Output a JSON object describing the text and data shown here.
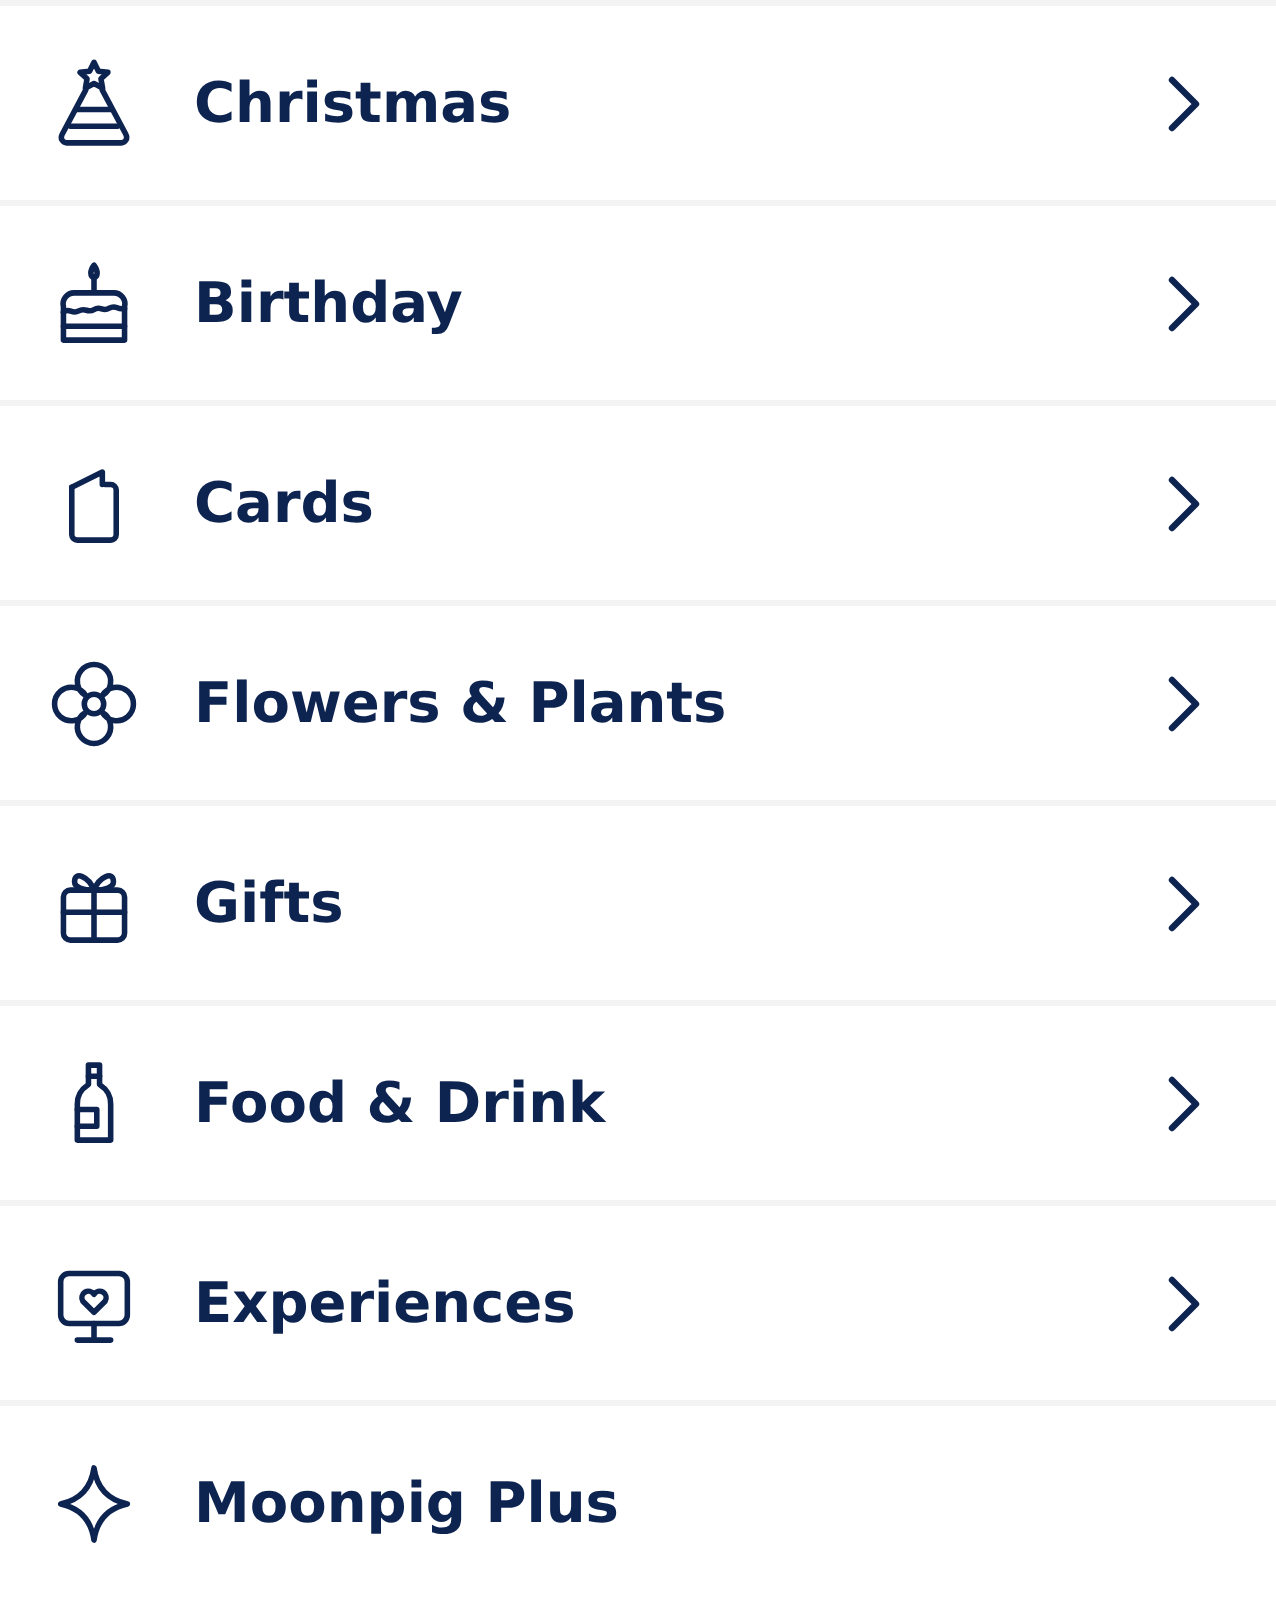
{
  "menu": [
    {
      "label": "Christmas",
      "has_submenu": true
    },
    {
      "label": "Birthday",
      "has_submenu": true
    },
    {
      "label": "Cards",
      "has_submenu": true
    },
    {
      "label": "Flowers & Plants",
      "has_submenu": true
    },
    {
      "label": "Gifts",
      "has_submenu": true
    },
    {
      "label": "Food & Drink",
      "has_submenu": true
    },
    {
      "label": "Experiences",
      "has_submenu": true
    },
    {
      "label": "Moonpig Plus",
      "has_submenu": false
    }
  ]
}
